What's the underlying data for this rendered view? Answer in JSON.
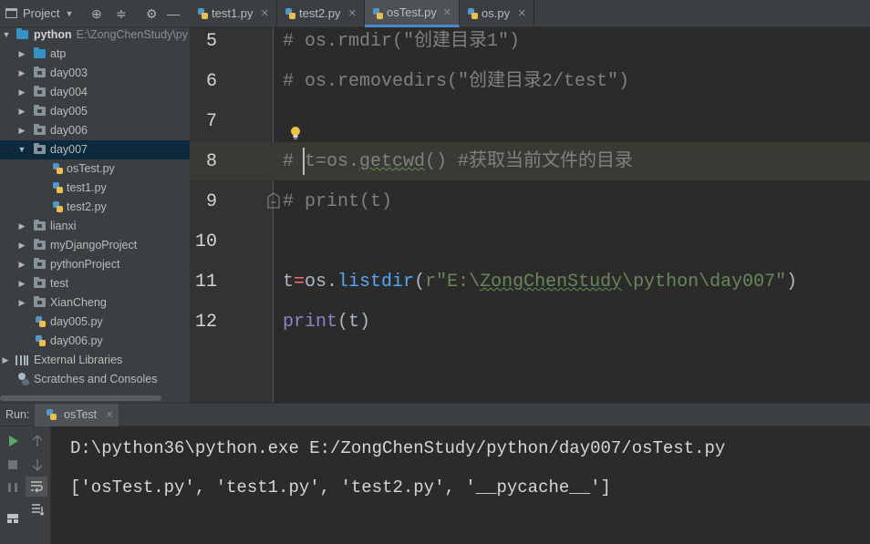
{
  "project_panel": {
    "title": "Project",
    "tree": [
      {
        "label": "python",
        "path": "E:\\ZongChenStudy\\py",
        "kind": "root-folder",
        "expanded": true
      },
      {
        "label": "atp",
        "kind": "folder",
        "expanded": false
      },
      {
        "label": "day003",
        "kind": "folder",
        "expanded": false
      },
      {
        "label": "day004",
        "kind": "folder",
        "expanded": false
      },
      {
        "label": "day005",
        "kind": "folder",
        "expanded": false
      },
      {
        "label": "day006",
        "kind": "folder",
        "expanded": false
      },
      {
        "label": "day007",
        "kind": "folder",
        "expanded": true,
        "selected": true
      },
      {
        "label": "osTest.py",
        "kind": "py-file"
      },
      {
        "label": "test1.py",
        "kind": "py-file"
      },
      {
        "label": "test2.py",
        "kind": "py-file"
      },
      {
        "label": "lianxi",
        "kind": "folder",
        "expanded": false
      },
      {
        "label": "myDjangoProject",
        "kind": "folder",
        "expanded": false
      },
      {
        "label": "pythonProject",
        "kind": "folder",
        "expanded": false
      },
      {
        "label": "test",
        "kind": "folder",
        "expanded": false
      },
      {
        "label": "XianCheng",
        "kind": "folder",
        "expanded": false
      },
      {
        "label": "day005.py",
        "kind": "py-file"
      },
      {
        "label": "day006.py",
        "kind": "py-file"
      },
      {
        "label": "External Libraries",
        "kind": "libraries"
      },
      {
        "label": "Scratches and Consoles",
        "kind": "scratches"
      }
    ]
  },
  "tabs": [
    {
      "label": "test1.py",
      "active": false
    },
    {
      "label": "test2.py",
      "active": false
    },
    {
      "label": "osTest.py",
      "active": true
    },
    {
      "label": "os.py",
      "active": false
    }
  ],
  "editor": {
    "line_numbers": [
      "5",
      "6",
      "7",
      "8",
      "9",
      "10",
      "11",
      "12"
    ],
    "code": {
      "l5": "# os.rmdir(\"创建目录1\")",
      "l6": "# os.removedirs(\"创建目录2/test\")",
      "l8_hash": "# ",
      "l8_rest_a": "t=os.",
      "l8_getcwd": "getcwd",
      "l8_rest_b": "() #获取当前文件的目录",
      "l9": "# print(t)",
      "l11_t": "t",
      "l11_eq": "=",
      "l11_os": "os.",
      "l11_fn": "listdir",
      "l11_paren": "(",
      "l11_str_a": "r\"E:\\",
      "l11_str_sq": "ZongChenStudy",
      "l11_str_b": "\\python\\day007\"",
      "l11_close": ")",
      "l12_fn": "print",
      "l12_rest": "(t)"
    }
  },
  "run": {
    "label": "Run:",
    "tab_label": "osTest",
    "output": [
      "D:\\python36\\python.exe E:/ZongChenStudy/python/day007/osTest.py",
      "['osTest.py', 'test1.py', 'test2.py', '__pycache__']"
    ]
  },
  "colors": {
    "background": "#2b2b2b",
    "panel": "#3c3f41",
    "selection": "#0d293e",
    "comment": "#808080",
    "builtin": "#8888c6",
    "string": "#6a8759",
    "run_green": "#59a869"
  }
}
